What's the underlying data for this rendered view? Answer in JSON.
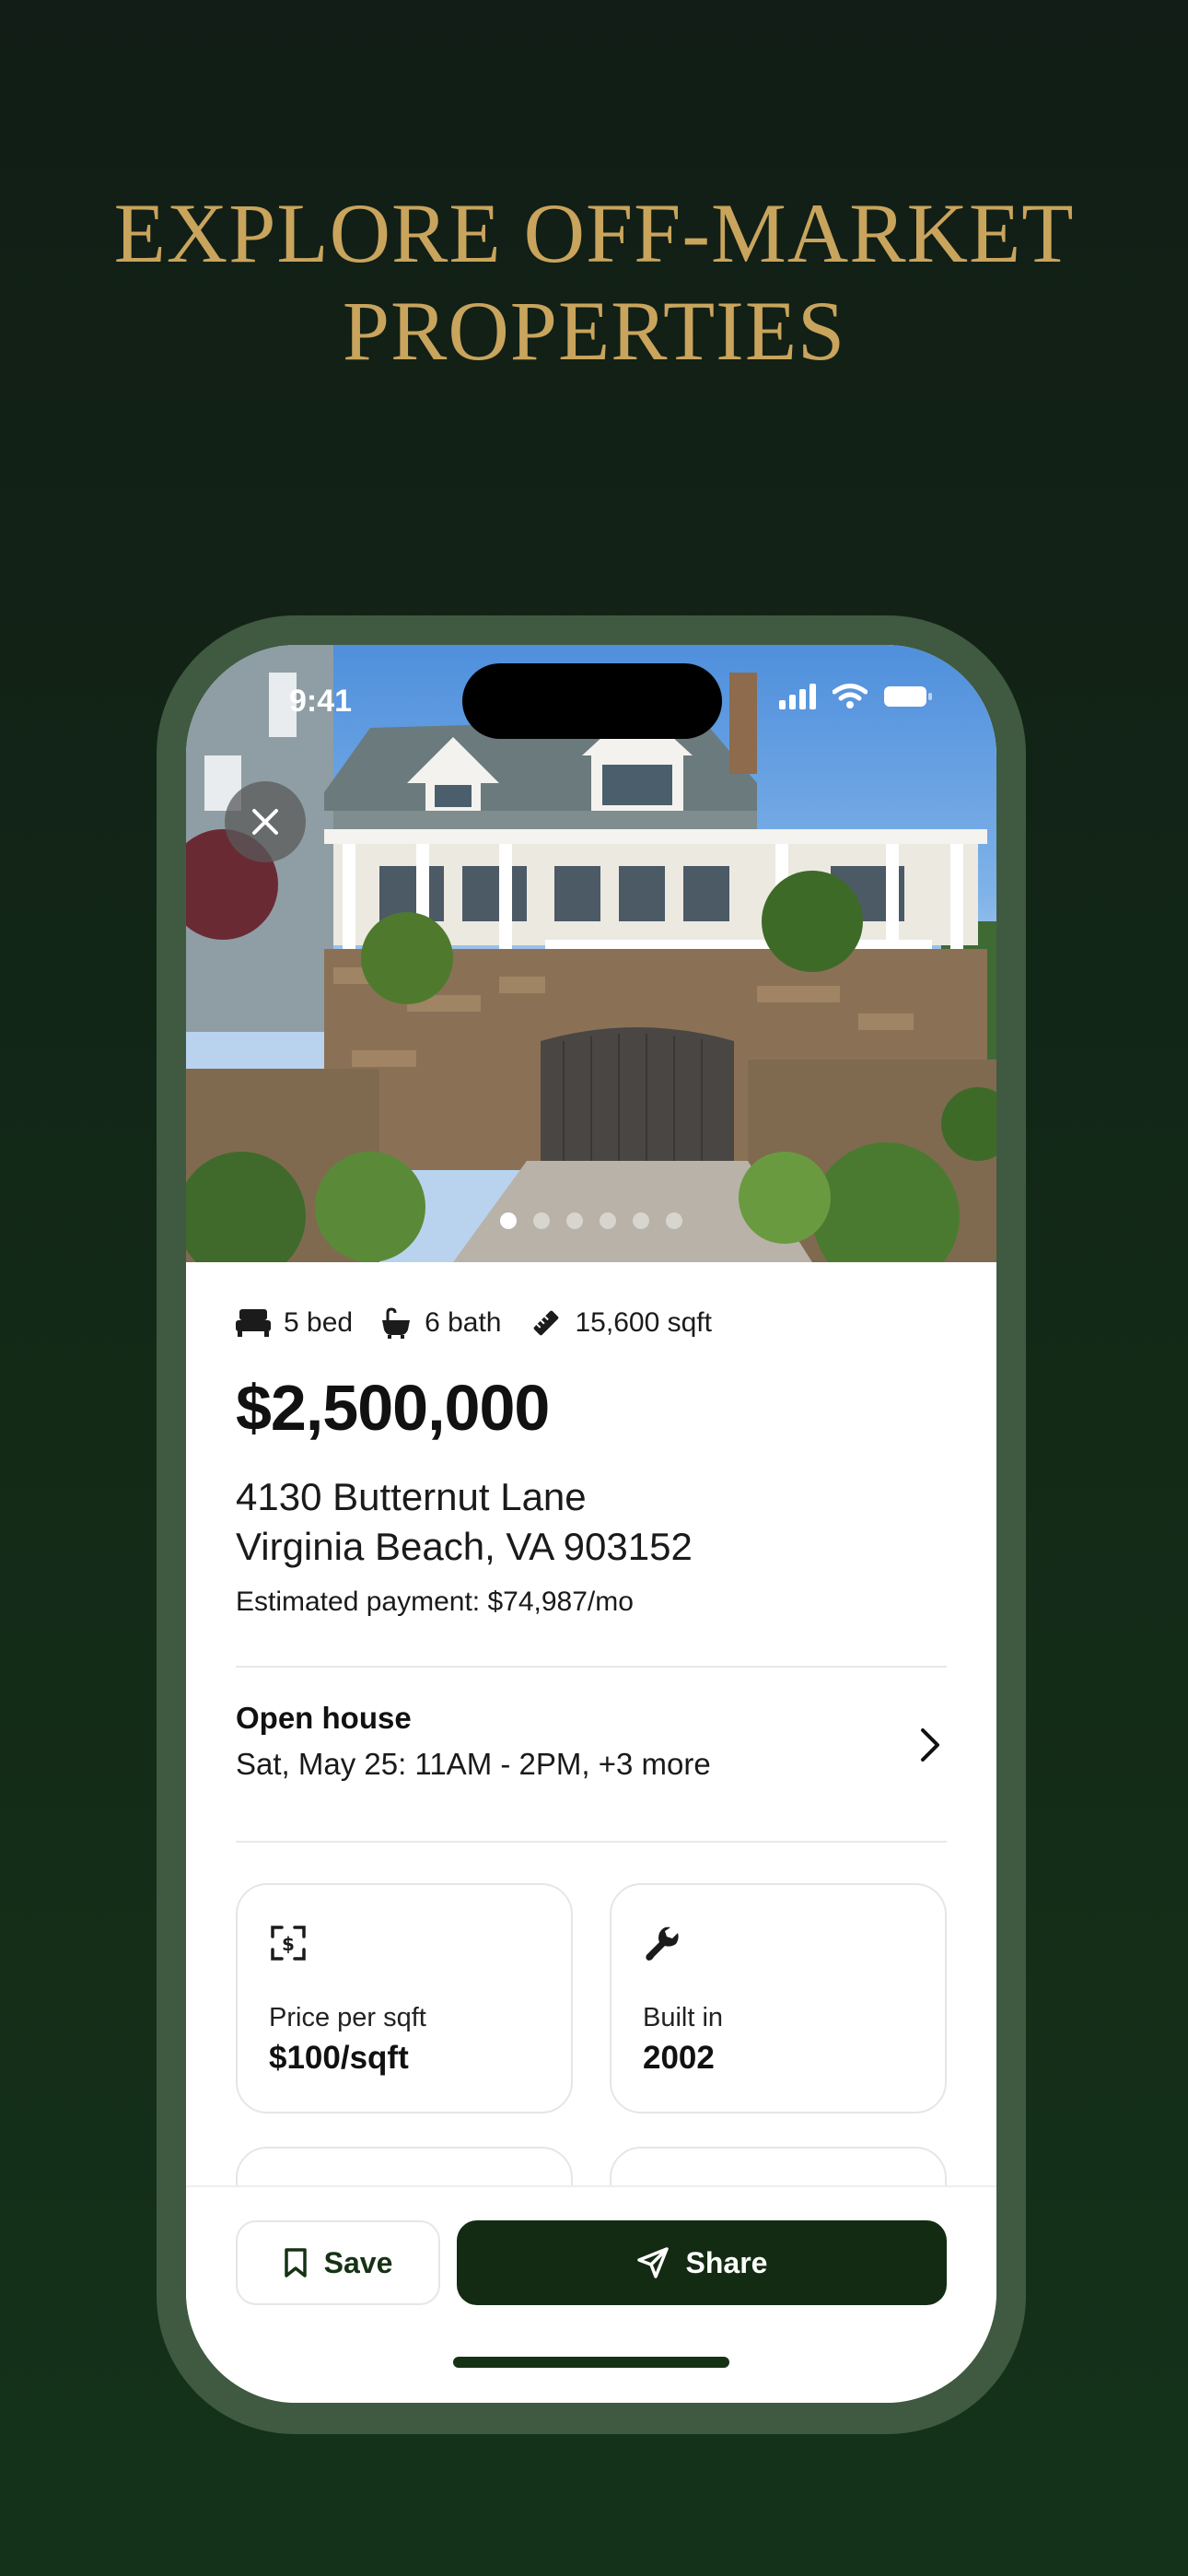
{
  "headline": {
    "line1": "EXPLORE OFF-MARKET",
    "line2": "PROPERTIES"
  },
  "status_bar": {
    "time": "9:41"
  },
  "gallery": {
    "total_images": 6,
    "active_index": 0
  },
  "listing": {
    "beds": "5 bed",
    "baths": "6 bath",
    "area": "15,600 sqft",
    "price": "$2,500,000",
    "address_line1": "4130 Butternut Lane",
    "address_line2": "Virginia Beach, VA 903152",
    "estimated_payment": "Estimated payment: $74,987/mo"
  },
  "open_house": {
    "title": "Open house",
    "details": "Sat, May 25: 11AM - 2PM, +3 more"
  },
  "cards": [
    {
      "label": "Price per sqft",
      "value": "$100/sqft",
      "icon": "dollar-scan-icon"
    },
    {
      "label": "Built in",
      "value": "2002",
      "icon": "wrench-icon"
    }
  ],
  "actions": {
    "save_label": "Save",
    "share_label": "Share"
  },
  "colors": {
    "accent_gold": "#c9a45c",
    "brand_green": "#132b12",
    "frame_green": "#3f5a41"
  }
}
